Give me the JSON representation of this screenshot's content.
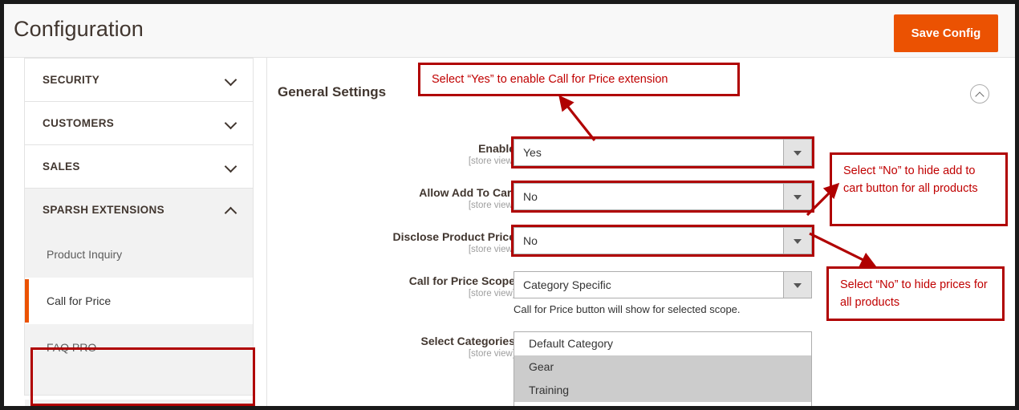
{
  "header": {
    "title": "Configuration",
    "save_label": "Save Config",
    "accent_color": "#eb5202"
  },
  "sidebar": {
    "sections": [
      {
        "label": "SECURITY",
        "state": "collapsed",
        "icon": "chevron-down-icon"
      },
      {
        "label": "CUSTOMERS",
        "state": "collapsed",
        "icon": "chevron-down-icon"
      },
      {
        "label": "SALES",
        "state": "collapsed",
        "icon": "chevron-down-icon"
      },
      {
        "label": "SPARSH EXTENSIONS",
        "state": "expanded",
        "icon": "chevron-up-icon"
      }
    ],
    "sub_items": [
      {
        "label": "Product Inquiry",
        "active": false
      },
      {
        "label": "Call for Price",
        "active": true
      },
      {
        "label": "FAQ PRO",
        "active": false
      }
    ],
    "active_highlight_color": "#b00000"
  },
  "content": {
    "section_title": "General Settings",
    "collapse_icon": "chevron-up-circle-icon",
    "scope_label": "[store view]",
    "fields": [
      {
        "label": "Enable",
        "scope": "[store view]",
        "value": "Yes",
        "flagged": true,
        "note": ""
      },
      {
        "label": "Allow Add To Cart",
        "scope": "[store view]",
        "value": "No",
        "flagged": true,
        "note": ""
      },
      {
        "label": "Disclose Product Price",
        "scope": "[store view]",
        "value": "No",
        "flagged": true,
        "note": ""
      },
      {
        "label": "Call for Price Scope",
        "scope": "[store view]",
        "value": "Category Specific",
        "flagged": false,
        "note": "Call for Price button will show for selected scope."
      }
    ],
    "categories_field": {
      "label": "Select Categories",
      "scope": "[store view]",
      "options": [
        {
          "label": "Default Category",
          "selected": false
        },
        {
          "label": "Gear",
          "selected": true
        },
        {
          "label": "Training",
          "selected": true
        }
      ]
    }
  },
  "annotations": [
    {
      "id": "enable",
      "text": "Select “Yes” to enable Call for Price extension"
    },
    {
      "id": "cart",
      "text": "Select “No” to hide add to cart button for all products"
    },
    {
      "id": "price",
      "text": "Select “No” to hide prices for all products"
    }
  ]
}
